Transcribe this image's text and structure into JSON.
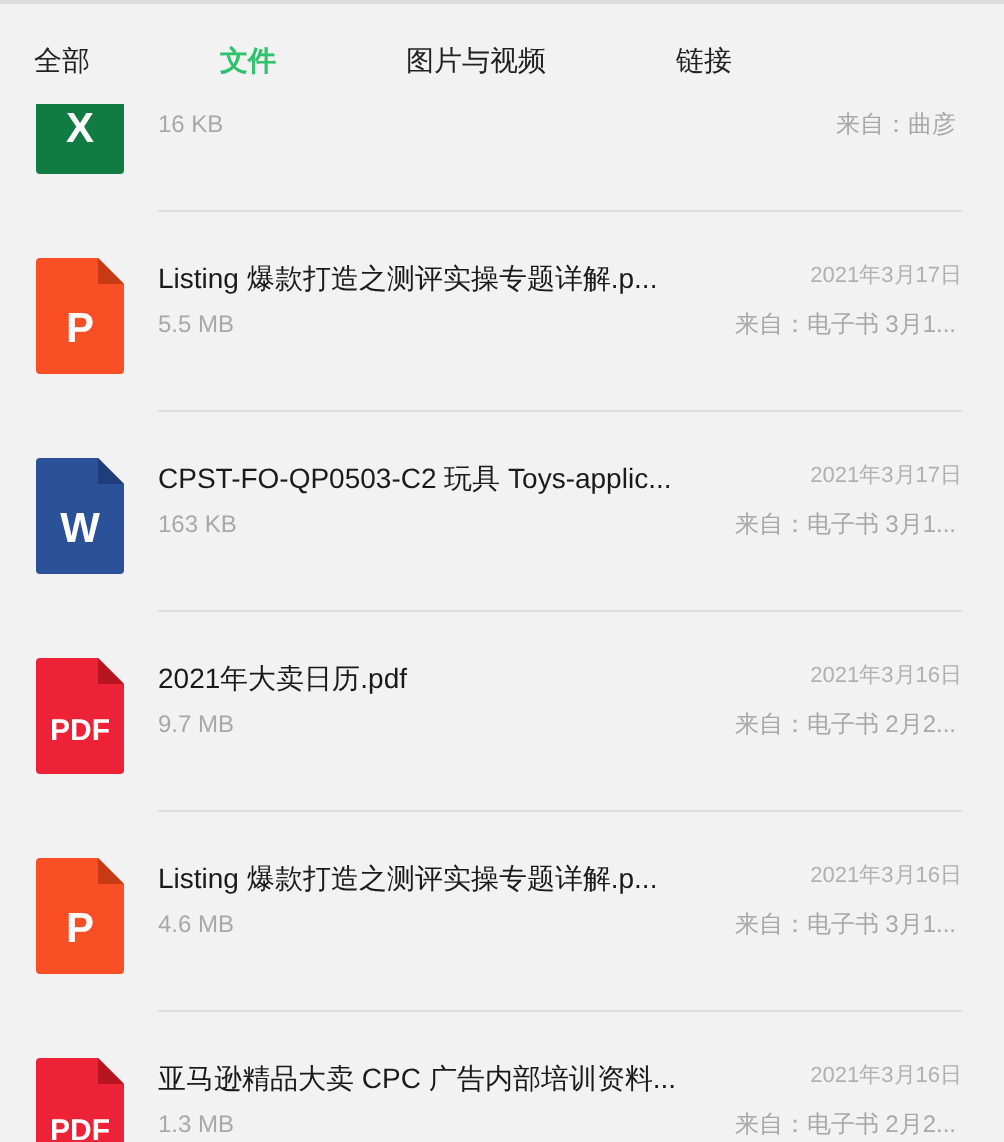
{
  "tabs": [
    {
      "label": "全部",
      "selected": false
    },
    {
      "label": "文件",
      "selected": true
    },
    {
      "label": "图片与视频",
      "selected": false
    },
    {
      "label": "链接",
      "selected": false
    }
  ],
  "files": [
    {
      "kind": "excel",
      "icon_label": "X",
      "size": "16 KB",
      "source": "来自：曲彦"
    },
    {
      "kind": "ppt",
      "icon_label": "P",
      "title": "Listing 爆款打造之测评实操专题详解.p...",
      "size": "5.5 MB",
      "date": "2021年3月17日",
      "source": "来自：电子书 3月1..."
    },
    {
      "kind": "word",
      "icon_label": "W",
      "title": "CPST-FO-QP0503-C2 玩具 Toys-applic...",
      "size": "163 KB",
      "date": "2021年3月17日",
      "source": "来自：电子书 3月1..."
    },
    {
      "kind": "pdf",
      "icon_label": "PDF",
      "title": "2021年大卖日历.pdf",
      "size": "9.7 MB",
      "date": "2021年3月16日",
      "source": "来自：电子书 2月2..."
    },
    {
      "kind": "ppt",
      "icon_label": "P",
      "title": "Listing 爆款打造之测评实操专题详解.p...",
      "size": "4.6 MB",
      "date": "2021年3月16日",
      "source": "来自：电子书 3月1..."
    },
    {
      "kind": "pdf",
      "icon_label": "PDF",
      "title": "亚马逊精品大卖 CPC 广告内部培训资料...",
      "size": "1.3 MB",
      "date": "2021年3月16日",
      "source": "来自：电子书 2月2..."
    }
  ]
}
